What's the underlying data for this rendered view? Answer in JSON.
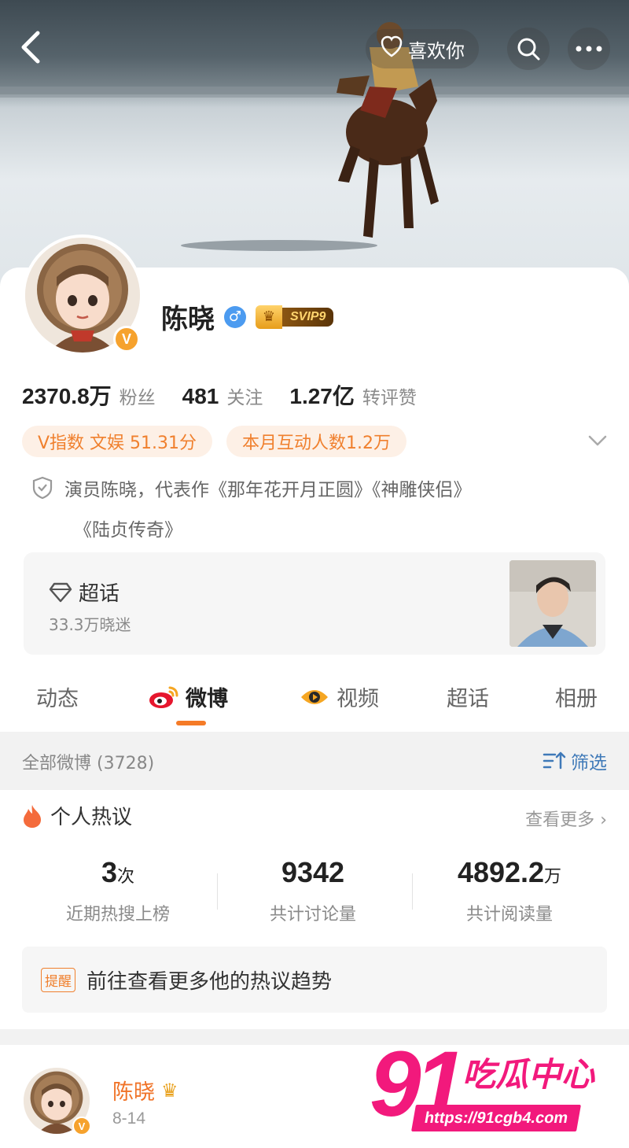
{
  "header": {
    "like_label": "喜欢你"
  },
  "profile": {
    "name": "陈晓",
    "gender": "♂",
    "verified": "V",
    "svip_label": "SVIP9",
    "stats": [
      {
        "value": "2370.8万",
        "label": "粉丝"
      },
      {
        "value": "481",
        "label": "关注"
      },
      {
        "value": "1.27亿",
        "label": "转评赞"
      }
    ],
    "chips": [
      "V指数 文娱 51.31分",
      "本月互动人数1.2万"
    ],
    "bio_line1": "演员陈晓，代表作《那年花开月正圆》《神雕侠侣》",
    "bio_line2": "《陆贞传奇》"
  },
  "super_topic": {
    "title": "超话",
    "subtitle": "33.3万晓迷"
  },
  "tabs": [
    {
      "label": "动态"
    },
    {
      "label": "微博"
    },
    {
      "label": "视频"
    },
    {
      "label": "超话"
    },
    {
      "label": "相册"
    }
  ],
  "feed_filter": {
    "count_label": "全部微博 (3728)",
    "filter_label": "筛选"
  },
  "hot": {
    "title": "个人热议",
    "more": "查看更多",
    "metrics": [
      {
        "value": "3",
        "unit": "次",
        "label": "近期热搜上榜"
      },
      {
        "value": "9342",
        "unit": "",
        "label": "共计讨论量"
      },
      {
        "value": "4892.2",
        "unit": "万",
        "label": "共计阅读量"
      }
    ],
    "remind_tag": "提醒",
    "remind_text": "前往查看更多他的热议趋势"
  },
  "post": {
    "author": "陈晓",
    "date": "8-14"
  },
  "watermark": {
    "number": "91",
    "name": "吃瓜中心",
    "url": "https://91cgb4.com"
  },
  "colors": {
    "accent": "#f57b27",
    "link": "#3f79b8",
    "watermark": "#f2197c"
  }
}
